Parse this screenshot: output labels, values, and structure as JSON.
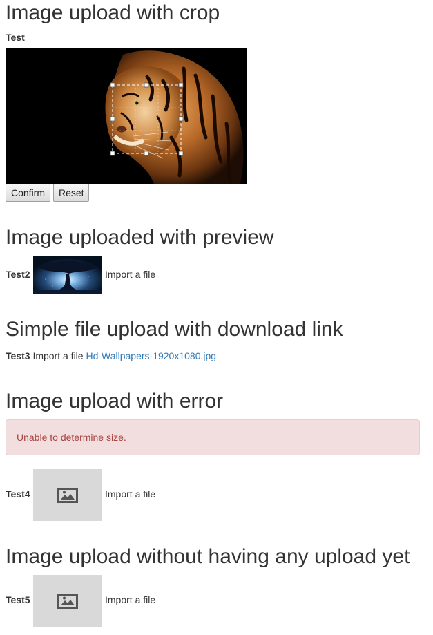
{
  "sections": [
    {
      "title": "Image upload with crop",
      "field_label": "Test",
      "buttons": {
        "confirm": "Confirm",
        "reset": "Reset"
      }
    },
    {
      "title": "Image uploaded with preview",
      "field_label": "Test2",
      "import_label": "Import a file"
    },
    {
      "title": "Simple file upload with download link",
      "field_label": "Test3",
      "import_label": "Import a file",
      "download_link": "Hd-Wallpapers-1920x1080.jpg"
    },
    {
      "title": "Image upload with error",
      "error_message": "Unable to determine size.",
      "field_label": "Test4",
      "import_label": "Import a file"
    },
    {
      "title": "Image upload without having any upload yet",
      "field_label": "Test5",
      "import_label": "Import a file"
    }
  ],
  "icons": {
    "placeholder": "image-placeholder-icon"
  },
  "colors": {
    "text": "#333333",
    "link": "#337ab7",
    "error_bg": "#f2dede",
    "error_border": "#ebccd1",
    "error_text": "#a94442",
    "placeholder_bg": "#d9d9d9"
  }
}
